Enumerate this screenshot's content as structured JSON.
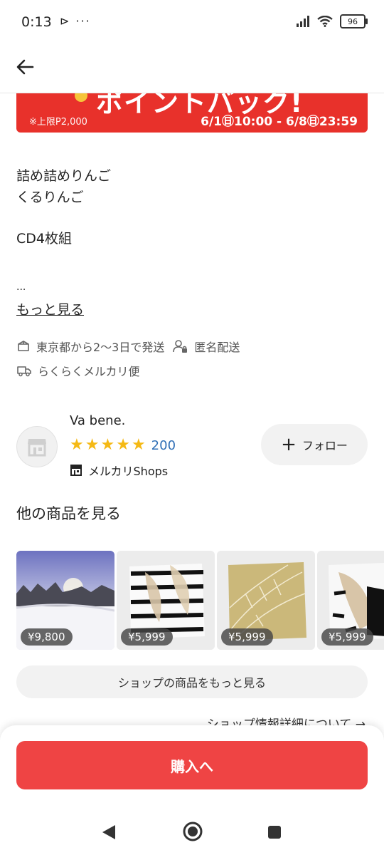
{
  "status": {
    "time": "0:13",
    "extra": "⊳ ···",
    "battery": "96"
  },
  "banner": {
    "headline": "ポイントバック!",
    "limit": "※上限P2,000",
    "date_range": "6/1㊐10:00 - 6/8㊐23:59"
  },
  "description": {
    "line1": "詰め詰めりんご",
    "line2": "くるりんご",
    "line3": "CD4枚組",
    "ellipsis": "...",
    "more_link": "もっと見る"
  },
  "shipping": {
    "origin": "東京都から2〜3日で発送",
    "anonymous": "匿名配送",
    "method": "らくらくメルカリ便"
  },
  "seller": {
    "name": "Va bene.",
    "rating_count": "200",
    "shops_label": "メルカリShops",
    "follow_label": "フォロー"
  },
  "other_items": {
    "title": "他の商品を見る",
    "items": [
      {
        "price": "¥9,800"
      },
      {
        "price": "¥5,999"
      },
      {
        "price": "¥5,999"
      },
      {
        "price": "¥5,999"
      }
    ],
    "shop_more_label": "ショップの商品をもっと見る",
    "shop_info_label": "ショップ情報詳細について →"
  },
  "buy_button": {
    "label": "購入へ"
  },
  "colors": {
    "accent_red": "#ef4444",
    "banner_red": "#e8312b",
    "star_yellow": "#f5b915",
    "link_blue": "#2f6fb6"
  }
}
